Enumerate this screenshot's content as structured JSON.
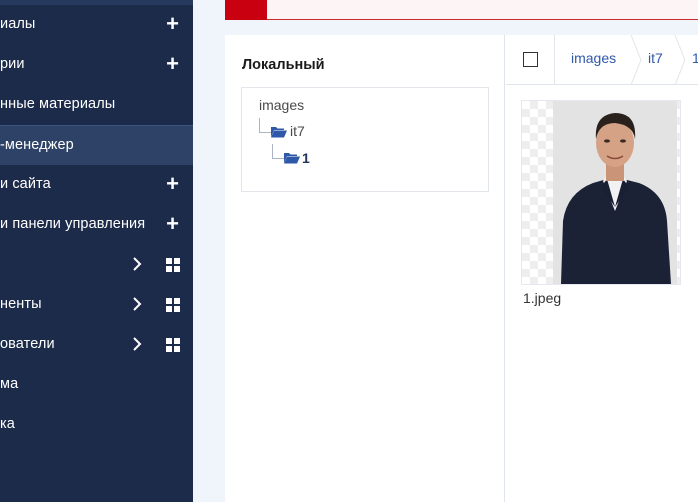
{
  "sidebar": {
    "items": [
      {
        "label": "иалы",
        "action": "plus"
      },
      {
        "label": "рии",
        "action": "plus"
      },
      {
        "label": "нные материалы",
        "action": ""
      },
      {
        "label": "-менеджер",
        "action": "",
        "active": true
      },
      {
        "label": "и сайта",
        "action": "plus"
      },
      {
        "label": "и панели управления",
        "action": "plus"
      },
      {
        "label": "",
        "action": "chevron-grid"
      },
      {
        "label": "ненты",
        "action": "chevron-grid"
      },
      {
        "label": "ователи",
        "action": "chevron-grid"
      },
      {
        "label": "ма",
        "action": ""
      },
      {
        "label": "ка",
        "action": ""
      }
    ],
    "plus_symbol": "+"
  },
  "folders": {
    "title": "Локальный",
    "tree": {
      "root": "images",
      "child": "it7",
      "grandchild": "1"
    }
  },
  "files": {
    "breadcrumb": [
      "images",
      "it7",
      "1"
    ],
    "items": [
      {
        "name": "1.jpeg"
      }
    ]
  },
  "colors": {
    "sidebar_bg": "#1c2b4a",
    "accent_blue": "#2f58a8",
    "alert_red": "#c9000f"
  }
}
